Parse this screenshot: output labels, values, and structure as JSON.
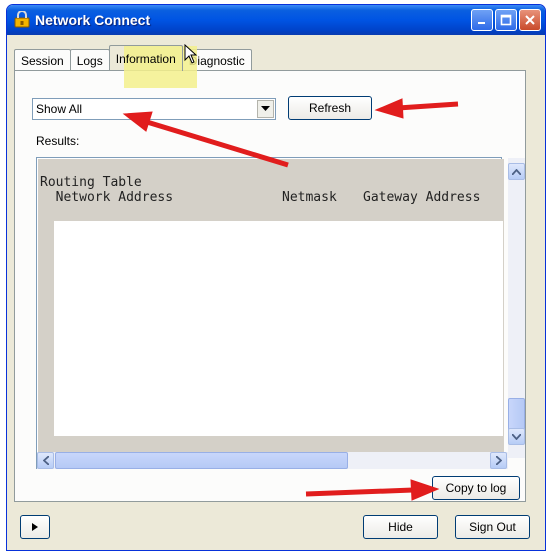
{
  "window": {
    "title": "Network Connect",
    "title_bar_color": "#0054e3"
  },
  "tabs": [
    {
      "label": "Session"
    },
    {
      "label": "Logs"
    },
    {
      "label": "Information",
      "active": true
    },
    {
      "label": "Diagnostic"
    }
  ],
  "filter": {
    "selected": "Show All"
  },
  "refresh_label": "Refresh",
  "results": {
    "label": "Results:",
    "lines": [
      "Routing Table",
      "  Network Address",
      "Netmask",
      "Gateway Address"
    ]
  },
  "copy_label": "Copy to log",
  "footer": {
    "hide_label": "Hide",
    "signout_label": "Sign Out"
  },
  "annotation_color": "#e11d1d",
  "highlight_color": "#f3f08c"
}
